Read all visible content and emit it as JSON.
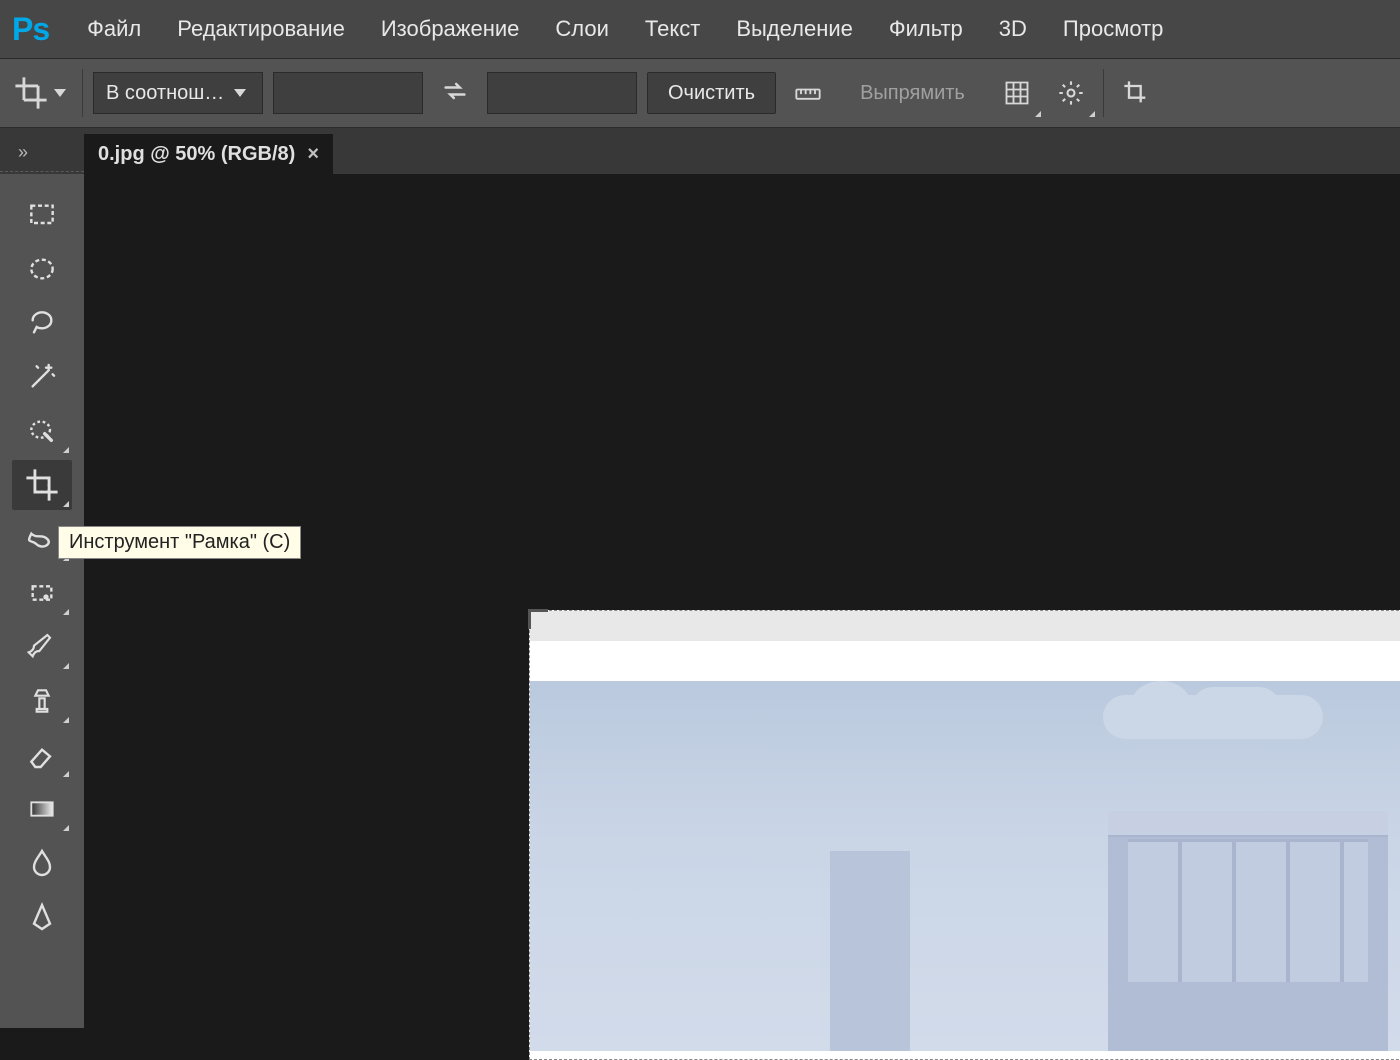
{
  "app": {
    "logo": "Ps"
  },
  "menubar": {
    "items": [
      "Файл",
      "Редактирование",
      "Изображение",
      "Слои",
      "Текст",
      "Выделение",
      "Фильтр",
      "3D",
      "Просмотр"
    ]
  },
  "optionsbar": {
    "ratio_dropdown": "В соотнош…",
    "clear_button": "Очистить",
    "straighten_button": "Выпрямить"
  },
  "tab": {
    "title": "0.jpg @ 50% (RGB/8)"
  },
  "toolbar_toggle": "»",
  "tools": [
    {
      "name": "rectangular-marquee",
      "active": false,
      "flyout": false
    },
    {
      "name": "elliptical-marquee",
      "active": false,
      "flyout": false
    },
    {
      "name": "lasso",
      "active": false,
      "flyout": false
    },
    {
      "name": "magic-wand",
      "active": false,
      "flyout": false
    },
    {
      "name": "quick-selection",
      "active": false,
      "flyout": true
    },
    {
      "name": "crop",
      "active": true,
      "flyout": true
    },
    {
      "name": "frame",
      "active": false,
      "flyout": true
    },
    {
      "name": "artboard",
      "active": false,
      "flyout": true
    },
    {
      "name": "brush",
      "active": false,
      "flyout": true
    },
    {
      "name": "clone-stamp",
      "active": false,
      "flyout": true
    },
    {
      "name": "eraser",
      "active": false,
      "flyout": true
    },
    {
      "name": "gradient",
      "active": false,
      "flyout": true
    },
    {
      "name": "blur",
      "active": false,
      "flyout": false
    },
    {
      "name": "pen",
      "active": false,
      "flyout": false
    }
  ],
  "tooltip": "Инструмент \"Рамка\" (C)"
}
